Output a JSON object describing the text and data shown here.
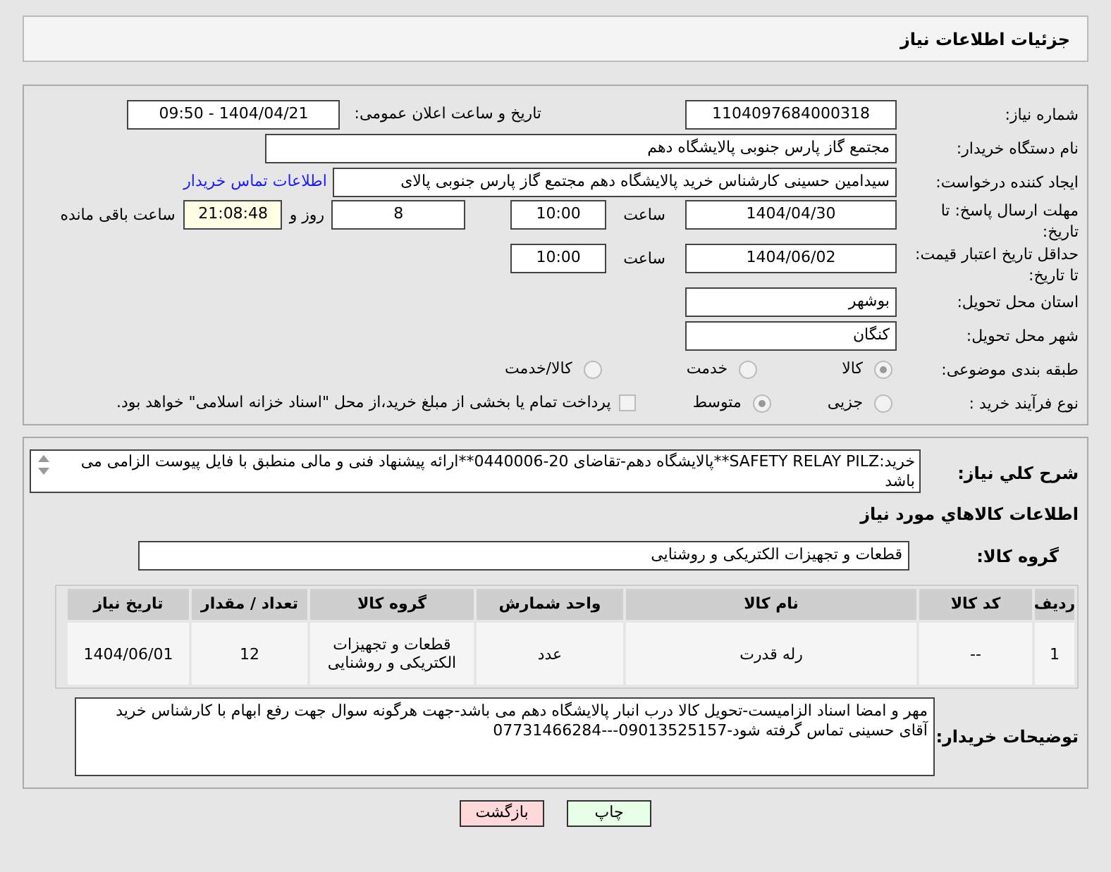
{
  "header": {
    "title": "جزئیات اطلاعات نیاز"
  },
  "need_number": {
    "label": "شماره نیاز:",
    "value": "1104097684000318"
  },
  "announce": {
    "label": "تاریخ و ساعت اعلان عمومی:",
    "value": "1404/04/21 - 09:50"
  },
  "buyer": {
    "label": "نام دستگاه خریدار:",
    "value": "مجتمع گاز پارس جنوبی  پالایشگاه دهم"
  },
  "requester": {
    "label": "ایجاد کننده درخواست:",
    "value": "سیدامین حسینی کارشناس خرید پالایشگاه دهم  مجتمع گاز پارس جنوبی  پالای",
    "link": "اطلاعات تماس خریدار"
  },
  "deadline": {
    "label": "مهلت ارسال پاسخ: تا تاریخ:",
    "date": "1404/04/30",
    "time_label": "ساعت",
    "time": "10:00",
    "days": "8",
    "days_label": "روز و",
    "remaining": "21:08:48",
    "remaining_label": "ساعت باقی مانده"
  },
  "validity": {
    "label": "حداقل تاریخ اعتبار قیمت: تا تاریخ:",
    "date": "1404/06/02",
    "time_label": "ساعت",
    "time": "10:00"
  },
  "province": {
    "label": "استان محل تحویل:",
    "value": "بوشهر"
  },
  "city": {
    "label": "شهر محل تحویل:",
    "value": "کنگان"
  },
  "category": {
    "label": "طبقه بندی موضوعی:",
    "options": [
      {
        "label": "کالا",
        "selected": true
      },
      {
        "label": "خدمت",
        "selected": false
      },
      {
        "label": "کالا/خدمت",
        "selected": false
      }
    ]
  },
  "process": {
    "label": "نوع فرآیند خرید :",
    "options": [
      {
        "label": "جزیی",
        "selected": false
      },
      {
        "label": "متوسط",
        "selected": true
      }
    ],
    "checkbox": {
      "label": "پرداخت تمام یا بخشی از مبلغ خرید،از محل \"اسناد خزانه اسلامی\" خواهد بود.",
      "checked": false
    }
  },
  "description": {
    "label": "شرح کلي نياز:",
    "value": "خرید:SAFETY RELAY PILZ**پالایشگاه دهم-تقاضای 20-0440006**ارائه پیشنهاد فنی و مالی منطبق با فایل پیوست الزامی می باشد"
  },
  "goods_title": "اطلاعات کالاهاي مورد نياز",
  "goods_group": {
    "label": "گروه کالا:",
    "value": "قطعات و تجهیزات الکتریکی و روشنایی"
  },
  "table": {
    "columns": [
      "ردیف",
      "کد کالا",
      "نام کالا",
      "واحد شمارش",
      "گروه کالا",
      "تعداد / مقدار",
      "تاریخ نیاز"
    ],
    "rows": [
      [
        "1",
        "--",
        "رله قدرت",
        "عدد",
        "قطعات و تجهیزات الکتریکی و روشنایی",
        "12",
        "1404/06/01"
      ]
    ]
  },
  "buyer_notes": {
    "label": "توضیحات خریدار:",
    "value": "مهر و امضا اسناد الزامیست-تحویل کالا درب انبار پالایشگاه دهم می باشد-جهت هرگونه سوال جهت رفع ابهام با کارشناس خرید\nآقای حسینی تماس گرفته شود-09013525157---07731466284"
  },
  "buttons": [
    {
      "label": "چاپ",
      "kind": "print"
    },
    {
      "label": "بازگشت",
      "kind": "back"
    }
  ]
}
